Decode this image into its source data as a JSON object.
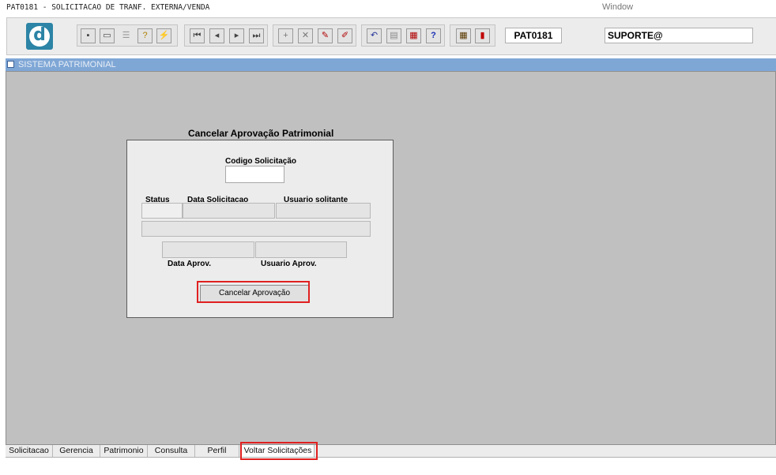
{
  "window": {
    "title": "PAT0181 - SOLICITACAO DE TRANF. EXTERNA/VENDA",
    "menu_window": "Window"
  },
  "toolbar": {
    "logo_letter": "d",
    "form_code": "PAT0181",
    "user": "SUPORTE@",
    "icons": [
      "save-icon",
      "window-icon",
      "print-icon",
      "query-icon",
      "execute-query-icon",
      "first-record-icon",
      "previous-record-icon",
      "next-record-icon",
      "last-record-icon",
      "insert-record-icon",
      "delete-record-icon",
      "edit-icon",
      "clear-icon",
      "undo-icon",
      "copy-icon",
      "paste-icon",
      "help-icon",
      "calculator-icon",
      "exit-icon"
    ]
  },
  "system_bar": {
    "label": "SISTEMA PATRIMONIAL"
  },
  "form": {
    "title": "Cancelar Aprovação Patrimonial",
    "codigo_label": "Codigo Solicitação",
    "codigo_value": "",
    "status_label": "Status",
    "data_solicitacao_label": "Data Solicitacao",
    "usuario_solicitante_label": "Usuario solitante",
    "data_aprov_label": "Data Aprov.",
    "usuario_aprov_label": "Usuario Aprov.",
    "cancel_button": "Cancelar Aprovação"
  },
  "tabs": [
    {
      "label": "Solicitacao",
      "active": false
    },
    {
      "label": "Gerencia",
      "active": false
    },
    {
      "label": "Patrimonio",
      "active": false
    },
    {
      "label": "Consulta",
      "active": false
    },
    {
      "label": "Perfil",
      "active": false
    },
    {
      "label": "Voltar Solicitações",
      "active": true
    }
  ],
  "colors": {
    "highlight": "#e02020",
    "system_bar": "#7fa7d6",
    "canvas": "#c0c0c0"
  }
}
